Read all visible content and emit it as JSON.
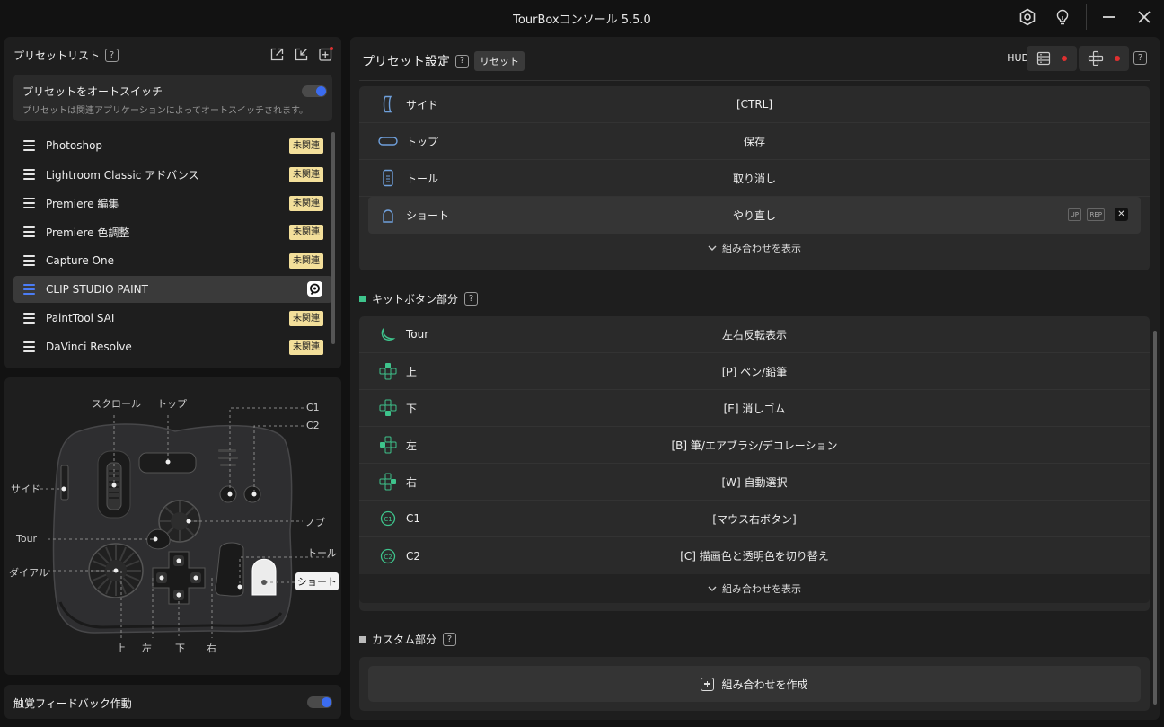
{
  "window": {
    "title": "TourBoxコンソール 5.5.0"
  },
  "preset_list": {
    "title": "プリセットリスト",
    "help": "?",
    "autoswitch": {
      "title": "プリセットをオートスイッチ",
      "description": "プリセットは関連アプリケーションによってオートスイッチされます。",
      "enabled": true
    },
    "items": [
      {
        "name": "Photoshop",
        "badge": "未関連"
      },
      {
        "name": "Lightroom Classic アドバンス",
        "badge": "未関連"
      },
      {
        "name": "Premiere 編集",
        "badge": "未関連"
      },
      {
        "name": "Premiere 色調整",
        "badge": "未関連"
      },
      {
        "name": "Capture One",
        "badge": "未関連"
      },
      {
        "name": "CLIP STUDIO PAINT",
        "badge": ""
      },
      {
        "name": "PaintTool SAI",
        "badge": "未関連"
      },
      {
        "name": "DaVinci Resolve",
        "badge": "未関連"
      }
    ]
  },
  "device": {
    "labels": {
      "scroll": "スクロール",
      "top": "トップ",
      "c1": "C1",
      "c2": "C2",
      "side": "サイド",
      "knob": "ノブ",
      "tour": "Tour",
      "tall": "トール",
      "dial": "ダイアル",
      "short": "ショート",
      "up": "上",
      "left": "左",
      "down": "下",
      "right": "右"
    }
  },
  "haptic": {
    "label": "触覚フィードバック作動",
    "enabled": true
  },
  "preset_settings": {
    "title": "プリセット設定",
    "help": "?",
    "reset": "リセット",
    "hud_label": "HUD",
    "main_rows": [
      {
        "name": "サイド",
        "value": "[CTRL]"
      },
      {
        "name": "トップ",
        "value": "保存"
      },
      {
        "name": "トール",
        "value": "取り消し"
      },
      {
        "name": "ショート",
        "value": "やり直し"
      }
    ],
    "row_tags": {
      "up": "UP",
      "rep": "REP",
      "close": "✕"
    },
    "show_combos": "組み合わせを表示",
    "kit_section": {
      "title": "キットボタン部分",
      "help": "?",
      "color": "#3ec48c",
      "rows": [
        {
          "name": "Tour",
          "value": "左右反転表示"
        },
        {
          "name": "上",
          "value": "[P] ペン/鉛筆"
        },
        {
          "name": "下",
          "value": "[E] 消しゴム"
        },
        {
          "name": "左",
          "value": "[B] 筆/エアブラシ/デコレーション"
        },
        {
          "name": "右",
          "value": "[W] 自動選択"
        },
        {
          "name": "C1",
          "value": "[マウス右ボタン]"
        },
        {
          "name": "C2",
          "value": "[C] 描画色と透明色を切り替え"
        }
      ],
      "show_combos": "組み合わせを表示"
    },
    "custom_section": {
      "title": "カスタム部分",
      "help": "?",
      "color": "#bbbbbb",
      "create_label": "組み合わせを作成"
    }
  },
  "icons": [
    "hexagon-gear-icon",
    "lightbulb-icon",
    "minimize-icon",
    "close-icon",
    "export-icon",
    "import-icon",
    "add-preset-icon",
    "hud-list-icon",
    "hud-dpad-icon",
    "chevron-down-icon",
    "plus-box-icon"
  ],
  "colors": {
    "accent": "#3b6cf0",
    "badge_bg": "#f3df9a",
    "kit_green": "#3ec48c",
    "hud_dot": "#e03030"
  }
}
